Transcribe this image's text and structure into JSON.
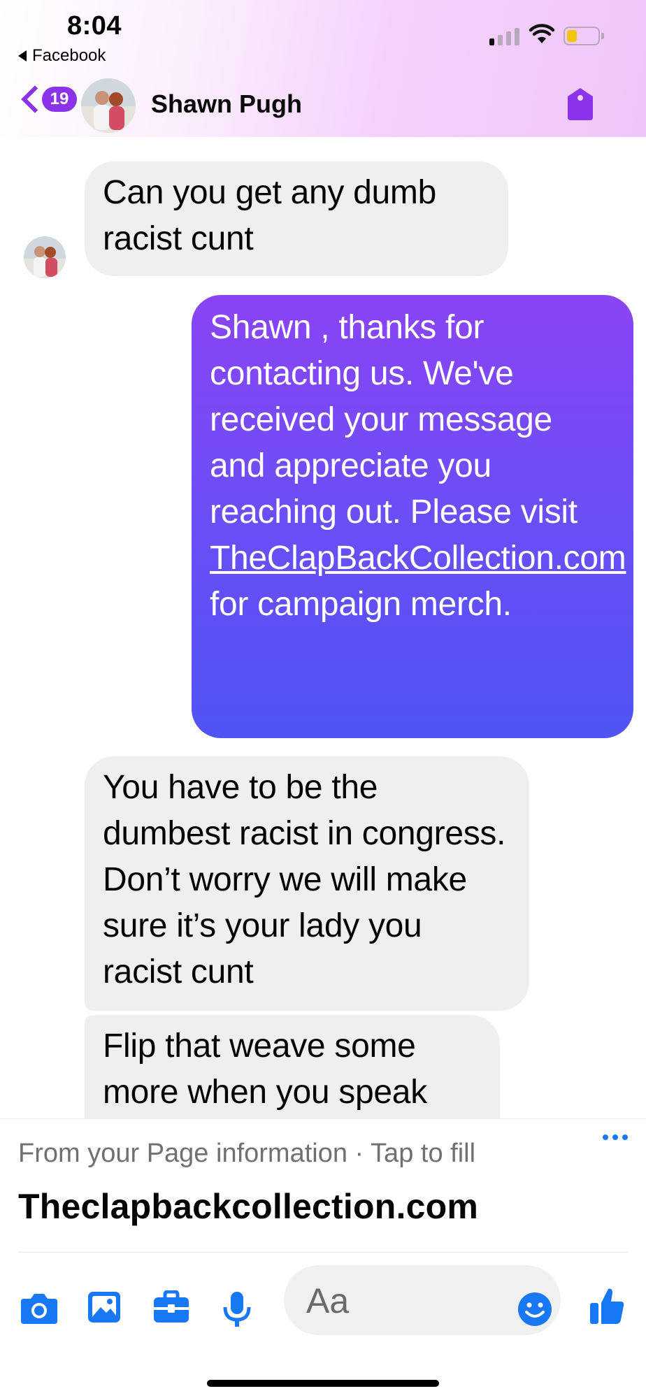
{
  "status_bar": {
    "time": "8:04",
    "back_app_label": "Facebook"
  },
  "header": {
    "unread_count": "19",
    "contact_name": "Shawn Pugh"
  },
  "messages": [
    {
      "direction": "incoming",
      "text": "Can you get any dumb racist cunt"
    },
    {
      "direction": "outgoing",
      "text_before_link": "Shawn , thanks for contacting us. We've received your message and appreciate you reaching out.  Please visit ",
      "link_text": "TheClapBackCollection.com",
      "text_after_link": " for campaign merch."
    },
    {
      "direction": "incoming",
      "text": "You have to be the dumbest racist in congress. Don’t worry we will make sure it’s your lady you racist cunt"
    },
    {
      "direction": "incoming",
      "text": "Flip that weave some more when you speak"
    }
  ],
  "autofill": {
    "hint": "From your Page information · Tap to fill",
    "value": "Theclapbackcollection.com"
  },
  "composer": {
    "placeholder": "Aa"
  },
  "colors": {
    "accent_purple": "#8a33e8",
    "facebook_blue": "#1877f2",
    "incoming_bubble": "#efefef",
    "outgoing_gradient_top": "#8a44f5",
    "outgoing_gradient_bottom": "#4f54f4"
  },
  "icons": [
    "signal-icon",
    "wifi-icon",
    "battery-icon",
    "back-chevron-icon",
    "tag-icon",
    "camera-icon",
    "gallery-icon",
    "briefcase-icon",
    "microphone-icon",
    "emoji-icon",
    "thumbs-up-icon",
    "more-icon"
  ]
}
